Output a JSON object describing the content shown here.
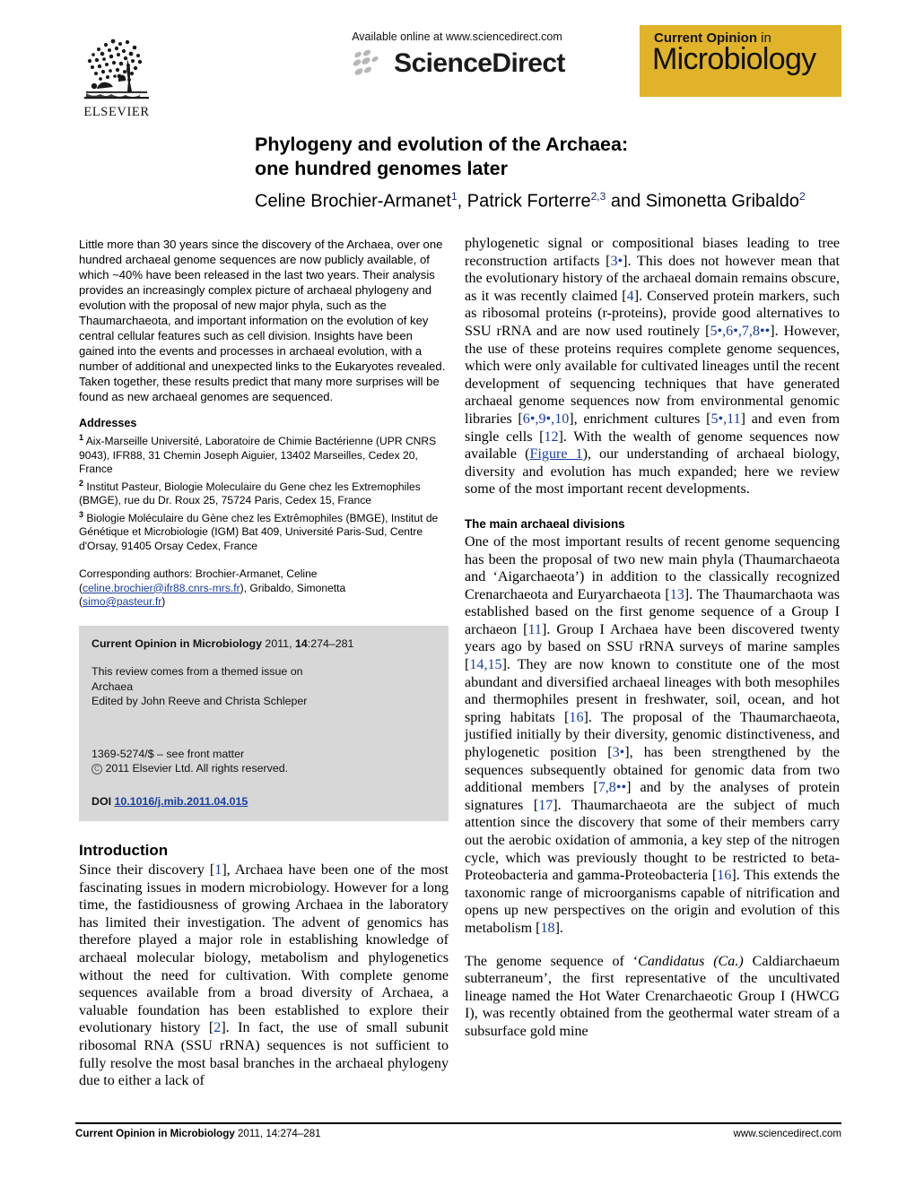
{
  "masthead": {
    "elsevier_wordmark": "ELSEVIER",
    "available_online": "Available online at www.sciencedirect.com",
    "sciencedirect_word": "ScienceDirect",
    "journal_logo_line1_bold": "Current Opinion",
    "journal_logo_line1_rest": " in",
    "journal_logo_line2": "Microbiology"
  },
  "title": {
    "line1": "Phylogeny and evolution of the Archaea:",
    "line2": "one hundred genomes later"
  },
  "authors": {
    "a1_name": "Celine Brochier-Armanet",
    "a1_sup": "1",
    "sep1": ", ",
    "a2_name": "Patrick Forterre",
    "a2_sup": "2,3",
    "sep2": " and ",
    "a3_name": "Simonetta Gribaldo",
    "a3_sup": "2"
  },
  "abstract": {
    "text": "Little more than 30 years since the discovery of the Archaea, over one hundred archaeal genome sequences are now publicly available, of which ~40% have been released in the last two years. Their analysis provides an increasingly complex picture of archaeal phylogeny and evolution with the proposal of new major phyla, such as the Thaumarchaeota, and important information on the evolution of key central cellular features such as cell division. Insights have been gained into the events and processes in archaeal evolution, with a number of additional and unexpected links to the Eukaryotes revealed. Taken together, these results predict that many more surprises will be found as new archaeal genomes are sequenced."
  },
  "addresses": {
    "heading": "Addresses",
    "items": [
      {
        "sup": "1",
        "text": "Aix-Marseille Université, Laboratoire de Chimie Bactérienne (UPR CNRS 9043), IFR88, 31 Chemin Joseph Aiguier, 13402 Marseilles, Cedex 20, France"
      },
      {
        "sup": "2",
        "text": "Institut Pasteur, Biologie Moleculaire du Gene chez les Extremophiles (BMGE), rue du Dr. Roux 25, 75724 Paris, Cedex 15, France"
      },
      {
        "sup": "3",
        "text": "Biologie Moléculaire du Gène chez les Extrêmophiles (BMGE), Institut de Génétique et Microbiologie (IGM) Bat 409, Université Paris-Sud, Centre d'Orsay, 91405 Orsay Cedex, France"
      }
    ]
  },
  "corresponding": {
    "line1": "Corresponding authors: Brochier-Armanet, Celine",
    "email1": "celine.brochier@ifr88.cnrs-mrs.fr",
    "mid": "), Gribaldo, Simonetta",
    "email2": "simo@pasteur.fr"
  },
  "infobox": {
    "journal_bold": "Current Opinion in Microbiology",
    "citation": " 2011, ",
    "volume": "14",
    "pages": ":274–281",
    "themed_line1": "This review comes from a themed issue on",
    "themed_line2": "Archaea",
    "edited_by": "Edited by John Reeve and Christa Schleper",
    "front_matter": "1369-5274/$ – see front matter",
    "copyright": "2011 Elsevier Ltd. All rights reserved.",
    "doi_label": "DOI",
    "doi_value": "10.1016/j.mib.2011.04.015"
  },
  "sections": {
    "introduction": {
      "heading": "Introduction",
      "p1_a": "Since their discovery [",
      "p1_ref1": "1",
      "p1_b": "], Archaea have been one of the most fascinating issues in modern microbiology. However for a long time, the fastidiousness of growing Archaea in the laboratory has limited their investigation. The advent of genomics has therefore played a major role in establishing knowledge of archaeal molecular biology, metabolism and phylogenetics without the need for cultivation. With complete genome sequences available from a broad diversity of Archaea, a valuable foundation has been established to explore their evolutionary history [",
      "p1_ref2": "2",
      "p1_c": "]. In fact, the use of small subunit ribosomal RNA (SSU rRNA) sequences is not sufficient to fully resolve the most basal branches in the archaeal phylogeny due to either a lack of"
    },
    "right_continuation": {
      "p2_a": "phylogenetic signal or compositional biases leading to tree reconstruction artifacts [",
      "p2_ref1": "3•",
      "p2_b": "]. This does not however mean that the evolutionary history of the archaeal domain remains obscure, as it was recently claimed [",
      "p2_ref2": "4",
      "p2_c": "]. Conserved protein markers, such as ribosomal proteins (r-proteins), provide good alternatives to SSU rRNA and are now used routinely [",
      "p2_ref3": "5•,6•,7,8••",
      "p2_d": "]. However, the use of these proteins requires complete genome sequences, which were only available for cultivated lineages until the recent development of sequencing techniques that have generated archaeal genome sequences now from environmental genomic libraries [",
      "p2_ref4": "6•,9•,10",
      "p2_e": "], enrichment cultures [",
      "p2_ref5": "5•,11",
      "p2_f": "] and even from single cells [",
      "p2_ref6": "12",
      "p2_g": "]. With the wealth of genome sequences now available (",
      "p2_figlink": "Figure 1",
      "p2_h": "), our understanding of archaeal biology, diversity and evolution has much expanded; here we review some of the most important recent developments."
    },
    "main_divisions": {
      "heading": "The main archaeal divisions",
      "p1_a": "One of the most important results of recent genome sequencing has been the proposal of two new main phyla (Thaumarchaeota and ‘Aigarchaeota’) in addition to the classically recognized Crenarchaeota and Euryarchaeota [",
      "p1_ref1": "13",
      "p1_b": "]. The Thaumarchaota was established based on the first genome sequence of a Group I archaeon [",
      "p1_ref2": "11",
      "p1_c": "]. Group I Archaea have been discovered twenty years ago by based on SSU rRNA surveys of marine samples [",
      "p1_ref3": "14,15",
      "p1_d": "]. They are now known to constitute one of the most abundant and diversified archaeal lineages with both mesophiles and thermophiles present in freshwater, soil, ocean, and hot spring habitats [",
      "p1_ref4": "16",
      "p1_e": "]. The proposal of the Thaumarchaeota, justified initially by their diversity, genomic distinctiveness, and phylogenetic position [",
      "p1_ref5": "3•",
      "p1_f": "], has been strengthened by the sequences subsequently obtained for genomic data from two additional members [",
      "p1_ref6": "7,8••",
      "p1_g": "] and by the analyses of protein signatures [",
      "p1_ref7": "17",
      "p1_h": "]. Thaumarchaeota are the subject of much attention since the discovery that some of their members carry out the aerobic oxidation of ammonia, a key step of the nitrogen cycle, which was previously thought to be restricted to beta-Proteobacteria and gamma-Proteobacteria [",
      "p1_ref8": "16",
      "p1_i": "]. This extends the taxonomic range of microorganisms capable of nitrification and opens up new perspectives on the origin and evolution of this metabolism [",
      "p1_ref9": "18",
      "p1_j": "].",
      "p2_a": "The genome sequence of ‘",
      "p2_it1": "Candidatus (Ca.)",
      "p2_b": " Caldiarchaeum subterraneum’, the first representative of the uncultivated lineage named the Hot Water Crenarchaeotic Group I (HWCG I), was recently obtained from the geothermal water stream of a subsurface gold mine"
    }
  },
  "footer": {
    "journal_bold": "Current Opinion in Microbiology",
    "citation": " 2011, 14:274–281",
    "site": "www.sciencedirect.com"
  },
  "colors": {
    "journal_logo_yellow": "#E0B32B",
    "link_blue": "#1a3fa0",
    "info_box_gray": "#d7d7d7"
  }
}
